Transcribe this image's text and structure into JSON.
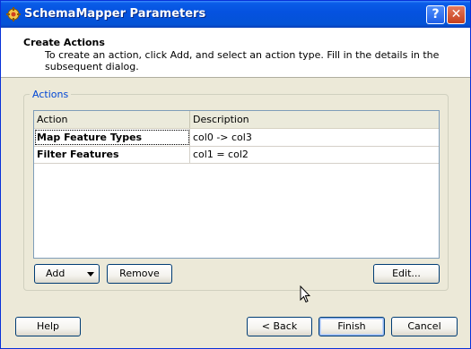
{
  "window": {
    "title": "SchemaMapper Parameters",
    "help_glyph": "?",
    "close_glyph": "✕"
  },
  "header": {
    "title": "Create Actions",
    "description": "To create an action, click Add, and select an action type. Fill in the details in the subsequent dialog."
  },
  "actions": {
    "group_label": "Actions",
    "columns": [
      "Action",
      "Description"
    ],
    "rows": [
      {
        "action": "Map Feature Types",
        "description": "col0 -> col3"
      },
      {
        "action": "Filter Features",
        "description": "col1 = col2"
      }
    ],
    "add_label": "Add",
    "remove_label": "Remove",
    "edit_label": "Edit..."
  },
  "footer": {
    "help_label": "Help",
    "back_label": "< Back",
    "finish_label": "Finish",
    "cancel_label": "Cancel"
  },
  "icons": {
    "app": "app-gear-icon",
    "dropdown": "chevron-down-icon",
    "cursor": "mouse-pointer-icon"
  },
  "colors": {
    "titlebar": "#0a5de8",
    "face": "#ece9d8",
    "group_label": "#0046d5",
    "button_border": "#003c74"
  }
}
